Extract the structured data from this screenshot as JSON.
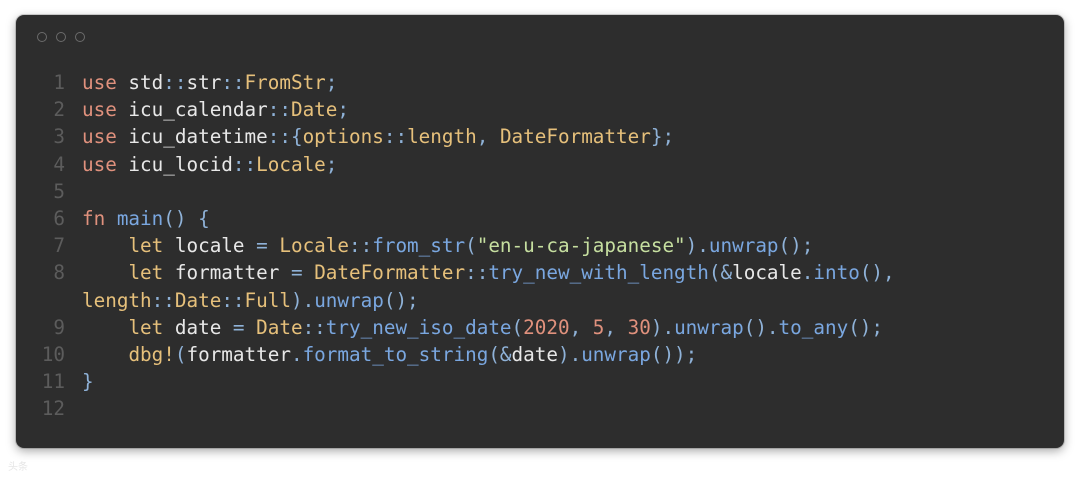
{
  "window": {
    "traffic_lights": [
      "close-dot",
      "minimize-dot",
      "zoom-dot"
    ]
  },
  "code": {
    "language": "rust",
    "lines": [
      {
        "n": "1",
        "t": [
          [
            "kw",
            "use"
          ],
          [
            "pl",
            " std"
          ],
          [
            "op",
            "::"
          ],
          [
            "pl",
            "str"
          ],
          [
            "op",
            "::"
          ],
          [
            "ty",
            "FromStr"
          ],
          [
            "op",
            ";"
          ]
        ]
      },
      {
        "n": "2",
        "t": [
          [
            "kw",
            "use"
          ],
          [
            "pl",
            " icu_calendar"
          ],
          [
            "op",
            "::"
          ],
          [
            "ty",
            "Date"
          ],
          [
            "op",
            ";"
          ]
        ]
      },
      {
        "n": "3",
        "t": [
          [
            "kw",
            "use"
          ],
          [
            "pl",
            " icu_datetime"
          ],
          [
            "op",
            "::{"
          ],
          [
            "ty",
            "options"
          ],
          [
            "op",
            "::"
          ],
          [
            "ty",
            "length"
          ],
          [
            "op",
            ", "
          ],
          [
            "ty",
            "DateFormatter"
          ],
          [
            "op",
            "};"
          ]
        ]
      },
      {
        "n": "4",
        "t": [
          [
            "kw",
            "use"
          ],
          [
            "pl",
            " icu_locid"
          ],
          [
            "op",
            "::"
          ],
          [
            "ty",
            "Locale"
          ],
          [
            "op",
            ";"
          ]
        ]
      },
      {
        "n": "5",
        "t": []
      },
      {
        "n": "6",
        "t": [
          [
            "kw",
            "fn"
          ],
          [
            "fn",
            " main"
          ],
          [
            "op",
            "() {"
          ]
        ]
      },
      {
        "n": "7",
        "t": [
          [
            "pl",
            "    "
          ],
          [
            "kw2",
            "let"
          ],
          [
            "pl",
            " locale "
          ],
          [
            "op",
            "="
          ],
          [
            "pl",
            " "
          ],
          [
            "ty",
            "Locale"
          ],
          [
            "op",
            "::"
          ],
          [
            "fn",
            "from_str"
          ],
          [
            "op",
            "("
          ],
          [
            "str",
            "\"en-u-ca-japanese\""
          ],
          [
            "op",
            ")."
          ],
          [
            "fn",
            "unwrap"
          ],
          [
            "op",
            "();"
          ]
        ]
      },
      {
        "n": "8",
        "t": [
          [
            "pl",
            "    "
          ],
          [
            "kw2",
            "let"
          ],
          [
            "pl",
            " formatter "
          ],
          [
            "op",
            "="
          ],
          [
            "pl",
            " "
          ],
          [
            "ty",
            "DateFormatter"
          ],
          [
            "op",
            "::"
          ],
          [
            "fn",
            "try_new_with_length"
          ],
          [
            "op",
            "(&"
          ],
          [
            "pl",
            "locale"
          ],
          [
            "op",
            "."
          ],
          [
            "fn",
            "into"
          ],
          [
            "op",
            "(),"
          ]
        ]
      },
      {
        "n": "",
        "t": [
          [
            "ty",
            "length"
          ],
          [
            "op",
            "::"
          ],
          [
            "ty",
            "Date"
          ],
          [
            "op",
            "::"
          ],
          [
            "ty",
            "Full"
          ],
          [
            "op",
            ")."
          ],
          [
            "fn",
            "unwrap"
          ],
          [
            "op",
            "();"
          ]
        ]
      },
      {
        "n": "9",
        "t": [
          [
            "pl",
            "    "
          ],
          [
            "kw2",
            "let"
          ],
          [
            "pl",
            " date "
          ],
          [
            "op",
            "="
          ],
          [
            "pl",
            " "
          ],
          [
            "ty",
            "Date"
          ],
          [
            "op",
            "::"
          ],
          [
            "fn",
            "try_new_iso_date"
          ],
          [
            "op",
            "("
          ],
          [
            "num",
            "2020"
          ],
          [
            "op",
            ", "
          ],
          [
            "num",
            "5"
          ],
          [
            "op",
            ", "
          ],
          [
            "num",
            "30"
          ],
          [
            "op",
            ")."
          ],
          [
            "fn",
            "unwrap"
          ],
          [
            "op",
            "()."
          ],
          [
            "fn",
            "to_any"
          ],
          [
            "op",
            "();"
          ]
        ]
      },
      {
        "n": "10",
        "t": [
          [
            "pl",
            "    "
          ],
          [
            "kw2",
            "dbg!"
          ],
          [
            "op",
            "("
          ],
          [
            "pl",
            "formatter"
          ],
          [
            "op",
            "."
          ],
          [
            "fn",
            "format_to_string"
          ],
          [
            "op",
            "(&"
          ],
          [
            "pl",
            "date"
          ],
          [
            "op",
            ")."
          ],
          [
            "fn",
            "unwrap"
          ],
          [
            "op",
            "());"
          ]
        ]
      },
      {
        "n": "11",
        "t": [
          [
            "op",
            "}"
          ]
        ]
      },
      {
        "n": "12",
        "t": []
      }
    ]
  },
  "watermark": "头条"
}
